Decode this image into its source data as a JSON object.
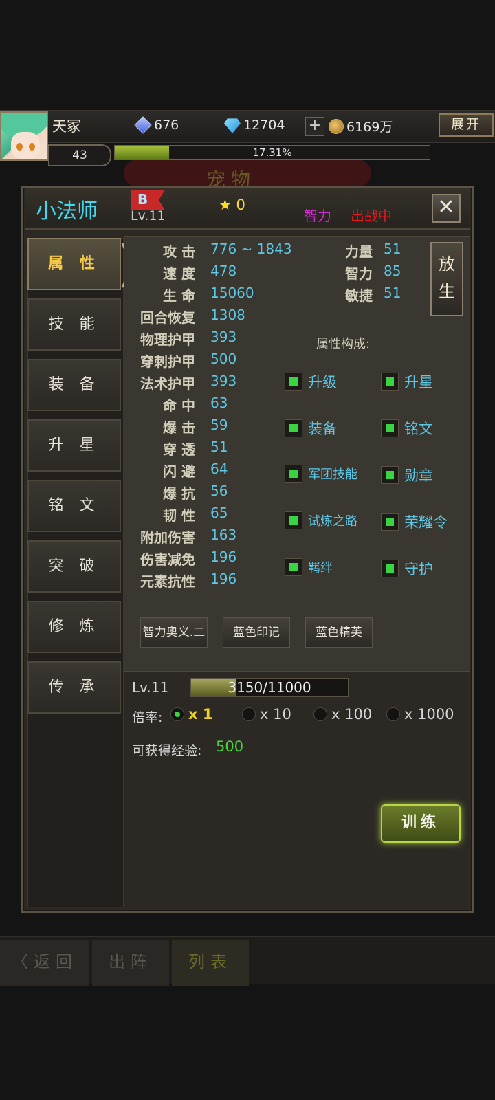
{
  "player": {
    "name": "天冢",
    "level": "43",
    "exp_percent": "17.31%",
    "exp_fraction": 0.1731
  },
  "resources": {
    "crystal": "676",
    "diamond": "12704",
    "gold": "6169万",
    "expand_label": "展开"
  },
  "background_title": "宠物",
  "hero": {
    "name": "小法师",
    "grade": "B",
    "level": "Lv.11",
    "stars": "★ 0",
    "type": "智力",
    "status": "出战中"
  },
  "tabs": [
    "属 性",
    "技 能",
    "装 备",
    "升 星",
    "铭 文",
    "突 破",
    "修 炼",
    "传 承"
  ],
  "active_tab": 0,
  "stats": [
    {
      "label": "攻 击",
      "value": "776 ~ 1843"
    },
    {
      "label": "速 度",
      "value": "478"
    },
    {
      "label": "生 命",
      "value": "15060"
    },
    {
      "label": "回合恢复",
      "value": "1308"
    },
    {
      "label": "物理护甲",
      "value": "393"
    },
    {
      "label": "穿刺护甲",
      "value": "500"
    },
    {
      "label": "法术护甲",
      "value": "393"
    },
    {
      "label": "命 中",
      "value": "63"
    },
    {
      "label": "爆 击",
      "value": "59"
    },
    {
      "label": "穿 透",
      "value": "51"
    },
    {
      "label": "闪 避",
      "value": "64"
    },
    {
      "label": "爆 抗",
      "value": "56"
    },
    {
      "label": "韧 性",
      "value": "65"
    },
    {
      "label": "附加伤害",
      "value": "163"
    },
    {
      "label": "伤害减免",
      "value": "196"
    },
    {
      "label": "元素抗性",
      "value": "196"
    }
  ],
  "attributes": [
    {
      "label": "力量",
      "value": "51"
    },
    {
      "label": "智力",
      "value": "85"
    },
    {
      "label": "敏捷",
      "value": "51"
    }
  ],
  "release_label": "放生",
  "composition_title": "属性构成:",
  "composition": [
    "升级",
    "升星",
    "装备",
    "铭文",
    "军团技能",
    "勋章",
    "试炼之路",
    "荣耀令",
    "羁绊",
    "守护"
  ],
  "skills": [
    "智力奥义.二",
    "蓝色印记",
    "蓝色精英"
  ],
  "training": {
    "level": "Lv.11",
    "progress_text": "3150/11000",
    "progress_fraction": 0.2864,
    "rate_label": "倍率:",
    "rates": [
      "x 1",
      "x 10",
      "x 100",
      "x 1000"
    ],
    "selected_rate": 0,
    "exp_label": "可获得经验:",
    "exp_value": "500",
    "train_label": "训练"
  },
  "bottom_nav": [
    "返回",
    "出阵",
    "列表"
  ],
  "colors": {
    "accent_cyan": "#3fd9f0",
    "stat_value": "#5cc8e6",
    "active_tab": "#f7c948",
    "status_red": "#e31b1b",
    "type_magenta": "#d02fd0",
    "exp_green": "#44d63c"
  }
}
